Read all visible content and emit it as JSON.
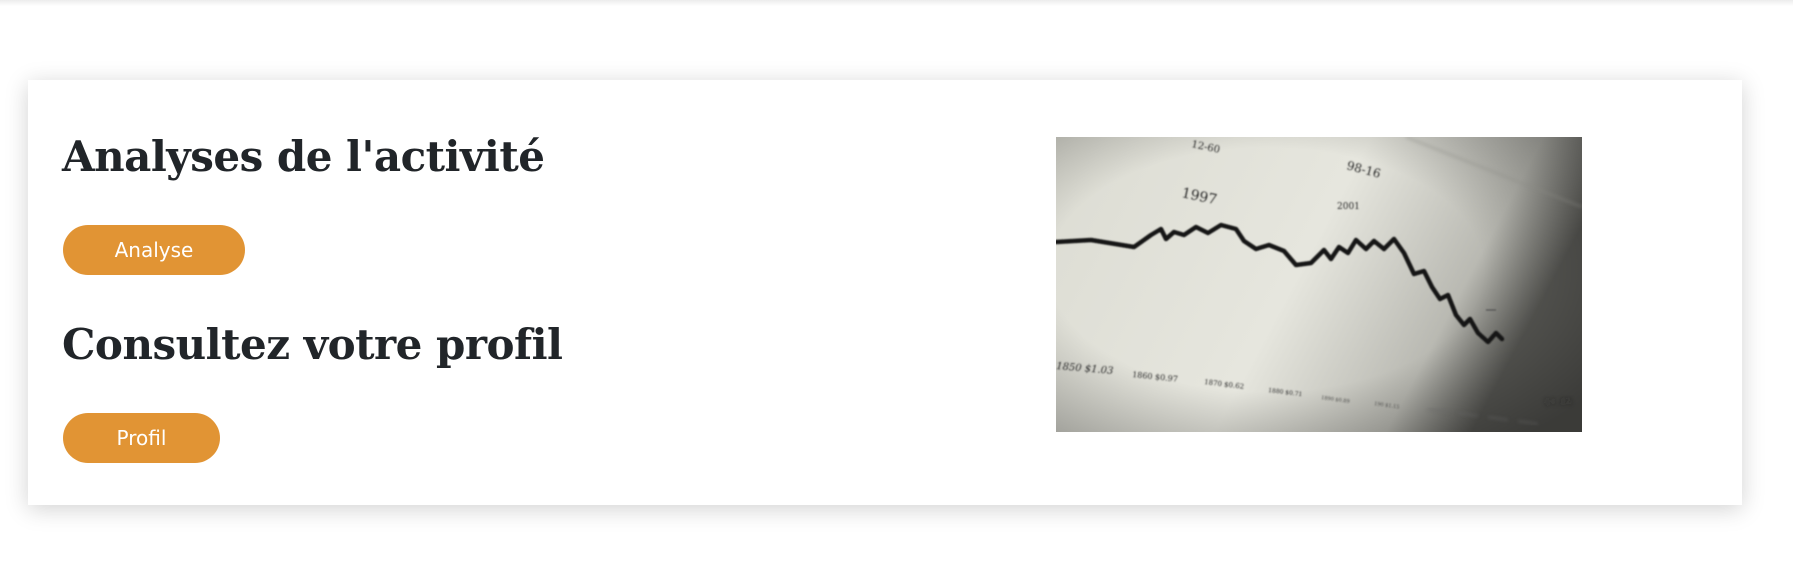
{
  "sections": [
    {
      "title": "Analyses de l'activité",
      "button_label": "Analyse"
    },
    {
      "title": "Consultez votre profil",
      "button_label": "Profil"
    }
  ],
  "image": {
    "description": "stock-chart-photo",
    "labels": {
      "year_1997": "1997",
      "year_2001": "2001",
      "top_a": "98-16",
      "top_b": "12-60",
      "axis_1": "1850 $1.03",
      "axis_2": "1860 $0.97",
      "axis_3": "1870 $0.62",
      "axis_4": "1880 $0.71",
      "axis_5": "1890 $0.89",
      "axis_6": "190 $1.15",
      "corner": "$1.85"
    }
  },
  "colors": {
    "accent": "#e19434",
    "heading": "#212529",
    "button_text": "#ffffff"
  }
}
